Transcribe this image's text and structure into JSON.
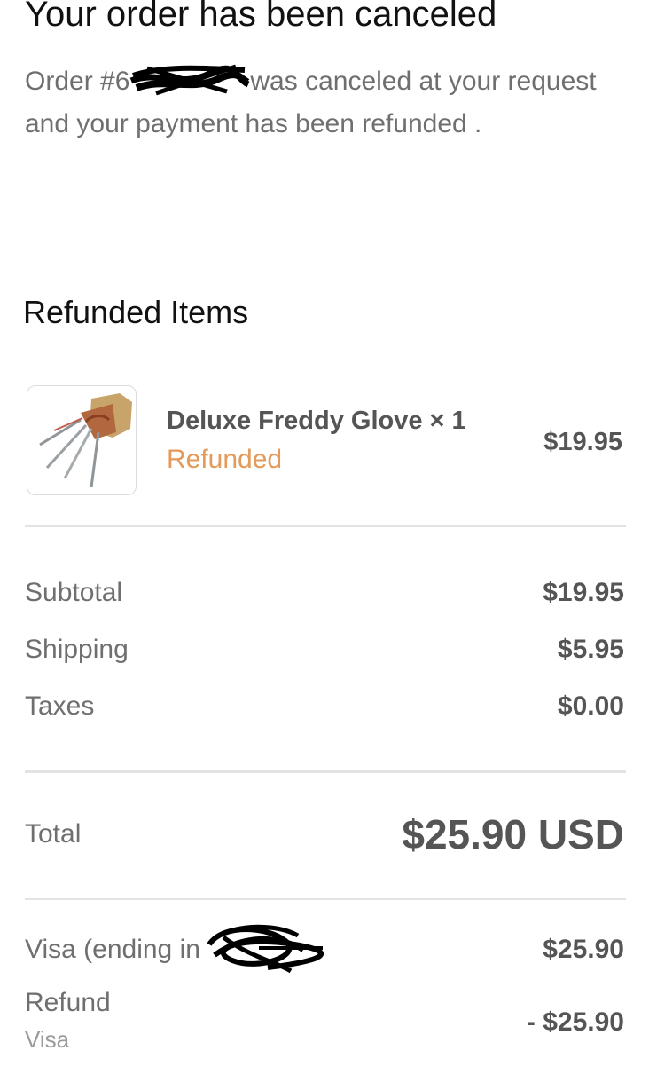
{
  "header": {
    "title": "Your order has been canceled",
    "message_prefix": "Order #6",
    "message_suffix": "was canceled at your request and your payment has been refunded ."
  },
  "refunded_items": {
    "section_title": "Refunded Items",
    "items": [
      {
        "name": "Deluxe Freddy Glove × 1",
        "status": "Refunded",
        "price": "$19.95",
        "image_icon": "claw-glove-product-image"
      }
    ]
  },
  "summary": {
    "subtotal_label": "Subtotal",
    "subtotal_value": "$19.95",
    "shipping_label": "Shipping",
    "shipping_value": "$5.95",
    "taxes_label": "Taxes",
    "taxes_value": "$0.00"
  },
  "total": {
    "label": "Total",
    "value": "$25.90 USD"
  },
  "payment": {
    "card_label": "Visa (ending in",
    "card_value": "$25.90",
    "refund_label": "Refund",
    "refund_method": "Visa",
    "refund_value": "- $25.90"
  },
  "colors": {
    "status_refunded": "#e39a5b",
    "muted_text": "#6f6f6f",
    "value_text": "#555555",
    "divider": "#e3e3e3"
  }
}
